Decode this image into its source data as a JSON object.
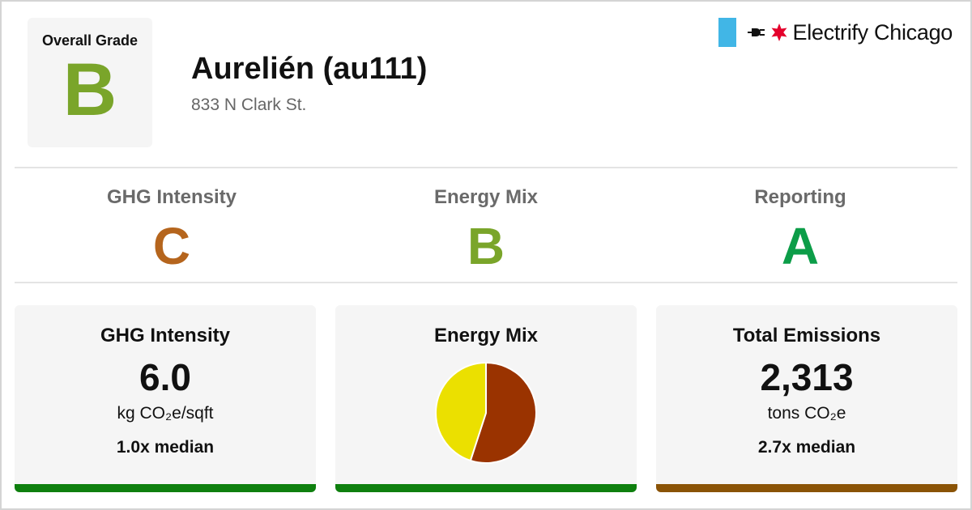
{
  "overall": {
    "label": "Overall Grade",
    "grade": "B",
    "grade_color": "#7aa52a"
  },
  "building": {
    "name": "Aurelién (au111)",
    "address": "833 N Clark St."
  },
  "logo": {
    "text": "Electrify Chicago",
    "flag_color": "#41b6e6",
    "star_color": "#e4002b"
  },
  "subgrades": [
    {
      "label": "GHG Intensity",
      "grade": "C",
      "color": "#b5651d"
    },
    {
      "label": "Energy Mix",
      "grade": "B",
      "color": "#7aa52a"
    },
    {
      "label": "Reporting",
      "grade": "A",
      "color": "#0c9d48"
    }
  ],
  "cards": {
    "ghg": {
      "title": "GHG Intensity",
      "value": "6.0",
      "unit": "kg CO₂e/sqft",
      "median": "1.0x median",
      "bar_color": "#0e7f0e"
    },
    "energy_mix": {
      "title": "Energy Mix",
      "bar_color": "#0e7f0e"
    },
    "emissions": {
      "title": "Total Emissions",
      "value": "2,313",
      "unit": "tons CO₂e",
      "median": "2.7x median",
      "bar_color": "#8a5306"
    }
  },
  "chart_data": {
    "type": "pie",
    "title": "",
    "slices": [
      {
        "label": "",
        "value": 55,
        "color": "#9a3300"
      },
      {
        "label": "",
        "value": 45,
        "color": "#ebe000"
      }
    ]
  }
}
